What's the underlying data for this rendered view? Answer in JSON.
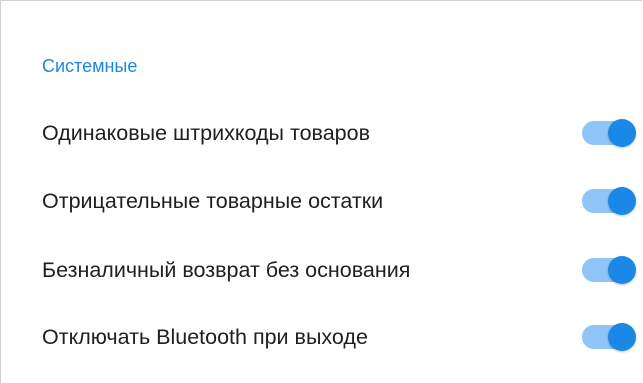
{
  "section": {
    "title": "Системные"
  },
  "settings": [
    {
      "label": "Одинаковые штрихкоды товаров",
      "enabled": true
    },
    {
      "label": "Отрицательные товарные остатки",
      "enabled": true
    },
    {
      "label": "Безналичный возврат без основания",
      "enabled": true
    },
    {
      "label": "Отключать Bluetooth при выходе",
      "enabled": true
    }
  ],
  "colors": {
    "accent": "#1a88e6",
    "toggle_track_on": "#8ec4f6",
    "text": "#1f1f1f",
    "border": "#cfcfcf"
  }
}
